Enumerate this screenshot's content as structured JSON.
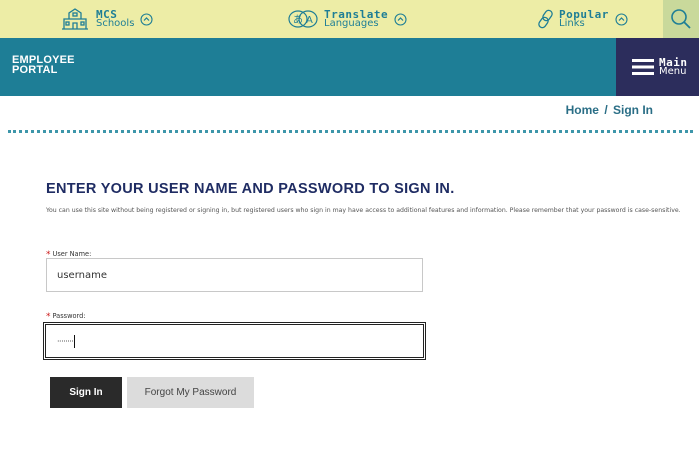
{
  "topbar": {
    "schools": {
      "strong": "MCS",
      "sub": "Schools"
    },
    "translate": {
      "strong": "Translate",
      "sub": "Languages"
    },
    "popular": {
      "strong": "Popular",
      "sub": "Links"
    }
  },
  "header": {
    "portal_line1": "EMPLOYEE",
    "portal_line2": "PORTAL",
    "menu_line1": "Main",
    "menu_line2": "Menu"
  },
  "breadcrumb": {
    "home": "Home",
    "sep": "/",
    "current": "Sign In"
  },
  "form": {
    "heading": "ENTER YOUR USER NAME AND PASSWORD TO SIGN IN.",
    "description": "You can use this site without being registered or signing in, but registered users who sign in may have access to additional features and information. Please remember that your password is case-sensitive.",
    "required_mark": "*",
    "username_label": "User Name:",
    "username_value": "username",
    "password_label": "Password:",
    "password_value": "········",
    "signin_label": "Sign In",
    "forgot_label": "Forgot My Password"
  },
  "colors": {
    "topbar_bg": "#ededa6",
    "brand_teal": "#1e7e96",
    "menu_navy": "#2c2d5c",
    "heading_navy": "#1f2c63"
  }
}
